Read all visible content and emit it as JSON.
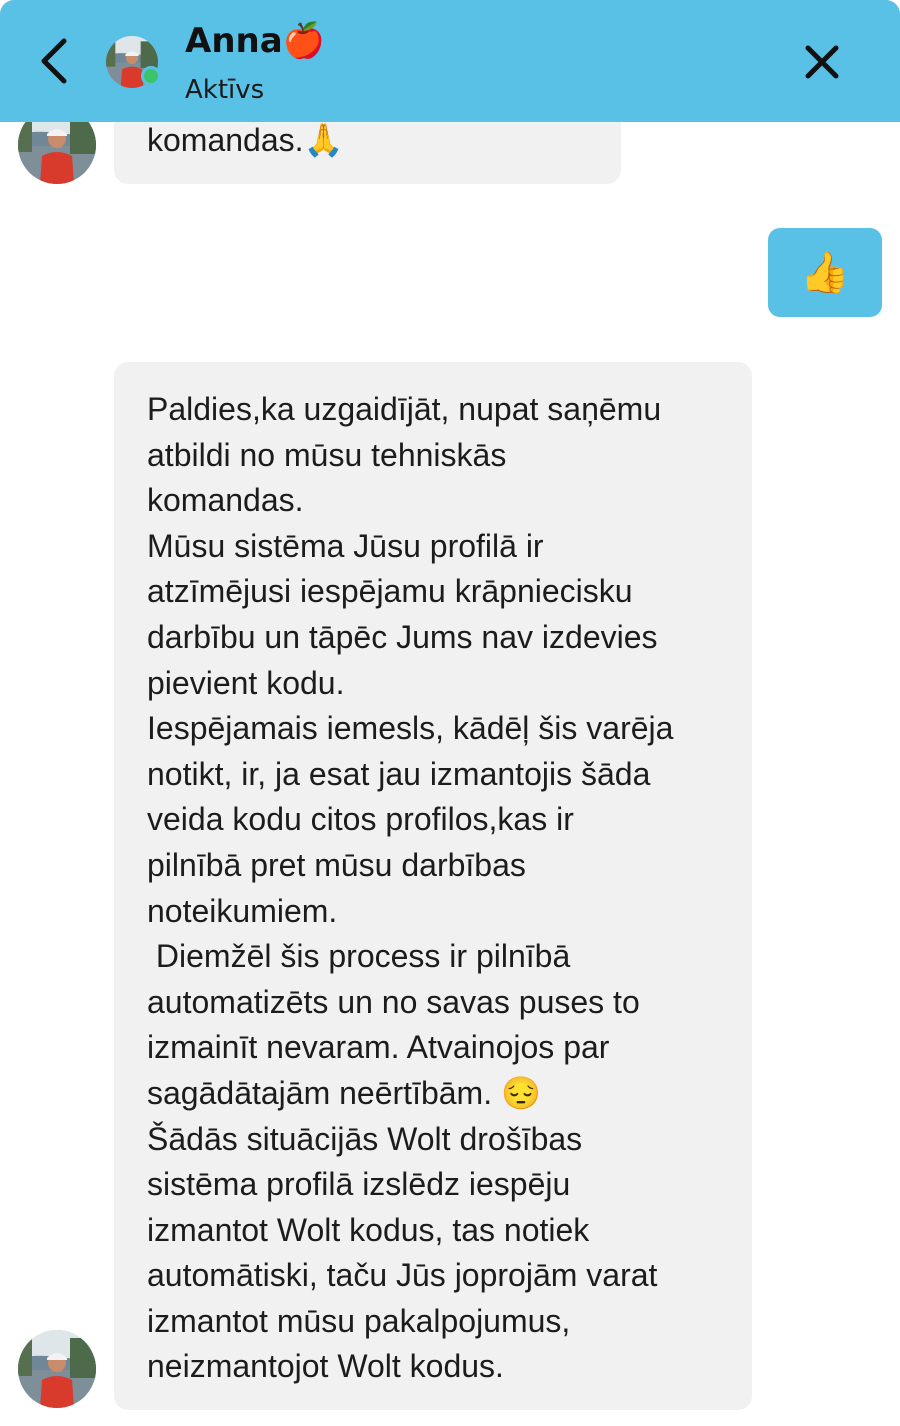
{
  "header": {
    "contact_name": "Anna🍎",
    "contact_status": "Aktīvs",
    "back_icon": "chevron-left-icon",
    "close_icon": "close-icon",
    "online_color": "#3bc46a",
    "bar_color": "#59c0e6"
  },
  "messages": [
    {
      "direction": "incoming",
      "text": "komandas.🙏"
    },
    {
      "direction": "outgoing",
      "text": "👍"
    },
    {
      "direction": "incoming",
      "text": "Paldies,ka uzgaidījāt, nupat saņēmu\natbildi no mūsu tehniskās\nkomandas.\nMūsu sistēma Jūsu profilā ir\natzīmējusi iespējamu krāpniecisku\ndarbību un tāpēc Jums nav izdevies\npievient kodu.\nIespējamais iemesls, kādēļ šis varēja\nnotikt, ir, ja esat jau izmantojis šāda\nveida kodu citos profilos,kas ir\npilnībā pret mūsu darbības\nnoteikumiem.\n Diemžēl šis process ir pilnībā\nautomatizēts un no savas puses to\nizmainīt nevaram. Atvainojos par\nsagādātajām neērtībām. 😔\nŠādās situācijās Wolt drošības\nsistēma profilā izslēdz iespēju\nizmantot Wolt kodus, tas notiek\nautomātiski, taču Jūs joprojām varat\nizmantot mūsu pakalpojumus,\nneizmantojot Wolt kodus."
    }
  ]
}
